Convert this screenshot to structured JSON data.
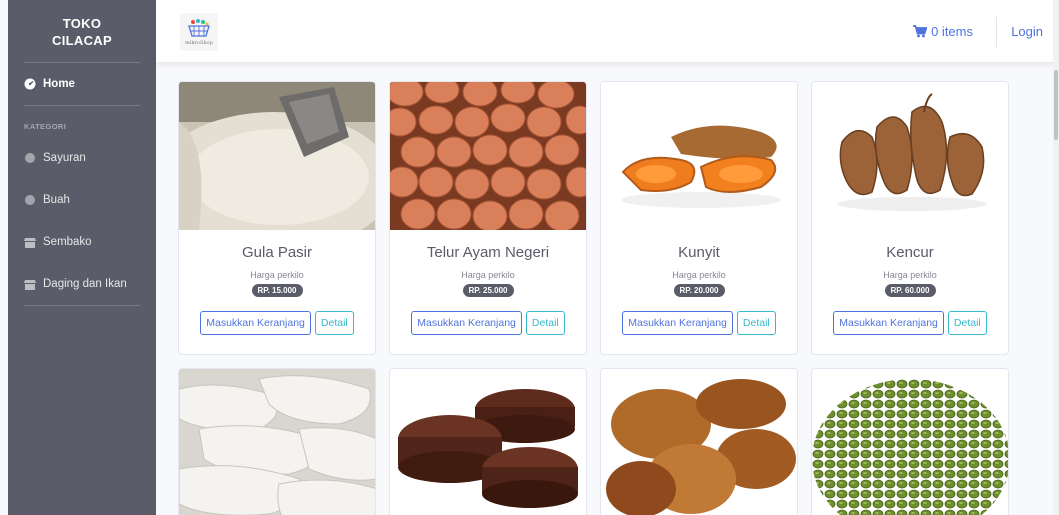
{
  "sidebar": {
    "brand_line1": "TOKO",
    "brand_line2": "CILACAP",
    "home": "Home",
    "heading": "KATEGORI",
    "items": [
      {
        "label": "Sayuran",
        "icon": "circle-icon"
      },
      {
        "label": "Buah",
        "icon": "circle-icon"
      },
      {
        "label": "Sembako",
        "icon": "store-icon"
      },
      {
        "label": "Daging dan Ikan",
        "icon": "store-icon"
      }
    ]
  },
  "topbar": {
    "logo_text": "mikroShop",
    "cart_label": "0 items",
    "login": "Login"
  },
  "products": [
    {
      "name": "Gula Pasir",
      "sub": "Harga perkilo",
      "price": "RP. 15.000",
      "btn": "Masukkan Keranjang",
      "detail": "Detail"
    },
    {
      "name": "Telur Ayam Negeri",
      "sub": "Harga perkilo",
      "price": "RP. 25.000",
      "btn": "Masukkan Keranjang",
      "detail": "Detail"
    },
    {
      "name": "Kunyit",
      "sub": "Harga perkilo",
      "price": "RP. 20.000",
      "btn": "Masukkan Keranjang",
      "detail": "Detail"
    },
    {
      "name": "Kencur",
      "sub": "Harga perkilo",
      "price": "RP. 60.000",
      "btn": "Masukkan Keranjang",
      "detail": "Detail"
    }
  ],
  "colors": {
    "primary": "#4e73df",
    "info": "#36b9cc",
    "sidebar": "#5a5c69"
  }
}
